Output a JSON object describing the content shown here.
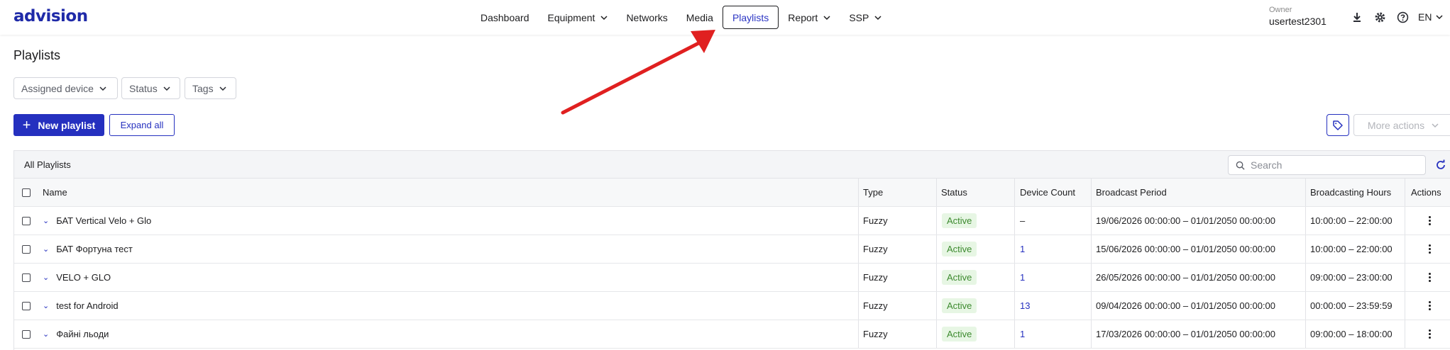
{
  "header": {
    "logo": "advision",
    "nav": [
      {
        "label": "Dashboard",
        "dropdown": false,
        "active": false
      },
      {
        "label": "Equipment",
        "dropdown": true,
        "active": false
      },
      {
        "label": "Networks",
        "dropdown": false,
        "active": false
      },
      {
        "label": "Media",
        "dropdown": false,
        "active": false
      },
      {
        "label": "Playlists",
        "dropdown": false,
        "active": true
      },
      {
        "label": "Report",
        "dropdown": true,
        "active": false
      },
      {
        "label": "SSP",
        "dropdown": true,
        "active": false
      }
    ],
    "owner_label": "Owner",
    "owner_name": "usertest2301",
    "language": "EN",
    "icons": [
      "download-icon",
      "gear-icon",
      "help-icon"
    ]
  },
  "page": {
    "title": "Playlists"
  },
  "filters": [
    {
      "label": "Assigned device"
    },
    {
      "label": "Status"
    },
    {
      "label": "Tags"
    }
  ],
  "actions": {
    "new_playlist": "New playlist",
    "expand_all": "Expand all",
    "more_actions": "More actions"
  },
  "table": {
    "title": "All Playlists",
    "search_placeholder": "Search",
    "columns": {
      "name": "Name",
      "type": "Type",
      "status": "Status",
      "device_count": "Device Count",
      "broadcast_period": "Broadcast Period",
      "broadcasting_hours": "Broadcasting Hours",
      "actions": "Actions"
    },
    "rows": [
      {
        "name": "БАТ Vertical Velo + Glo",
        "type": "Fuzzy",
        "status": "Active",
        "device_count": "–",
        "broadcast_period": "19/06/2026 00:00:00 – 01/01/2050 00:00:00",
        "broadcasting_hours": "10:00:00 – 22:00:00"
      },
      {
        "name": "БАТ Фортуна тест",
        "type": "Fuzzy",
        "status": "Active",
        "device_count": "1",
        "broadcast_period": "15/06/2026 00:00:00 – 01/01/2050 00:00:00",
        "broadcasting_hours": "10:00:00 – 22:00:00"
      },
      {
        "name": "VELO + GLO",
        "type": "Fuzzy",
        "status": "Active",
        "device_count": "1",
        "broadcast_period": "26/05/2026 00:00:00 – 01/01/2050 00:00:00",
        "broadcasting_hours": "09:00:00 – 23:00:00"
      },
      {
        "name": "test for Android",
        "type": "Fuzzy",
        "status": "Active",
        "device_count": "13",
        "broadcast_period": "09/04/2026 00:00:00 – 01/01/2050 00:00:00",
        "broadcasting_hours": "00:00:00 – 23:59:59"
      },
      {
        "name": "Файні льоди",
        "type": "Fuzzy",
        "status": "Active",
        "device_count": "1",
        "broadcast_period": "17/03/2026 00:00:00 – 01/01/2050 00:00:00",
        "broadcasting_hours": "09:00:00 – 18:00:00"
      }
    ]
  },
  "colors": {
    "brand": "#1f2aa8",
    "primary": "#2530bf",
    "active_badge_bg": "#e7f6e4",
    "active_badge_text": "#3d8a2f",
    "annotation_arrow": "#e02020"
  }
}
